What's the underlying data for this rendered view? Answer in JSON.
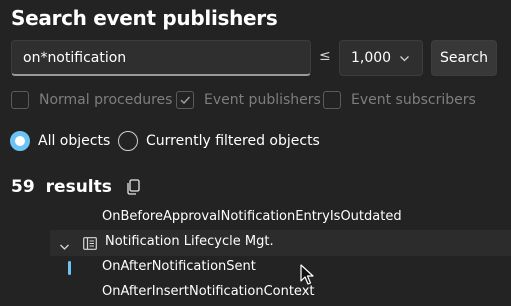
{
  "header": {
    "title": "Search event publishers"
  },
  "search": {
    "query": "on*notification",
    "le_symbol": "≤",
    "limit_value": "1,000",
    "button_label": "Search"
  },
  "filters": {
    "checkboxes": [
      {
        "label": "Normal procedures",
        "checked": false
      },
      {
        "label": "Event publishers",
        "checked": true
      },
      {
        "label": "Event subscribers",
        "checked": false
      }
    ]
  },
  "scope": {
    "options": [
      {
        "label": "All objects",
        "selected": true
      },
      {
        "label": "Currently filtered objects",
        "selected": false
      }
    ]
  },
  "results": {
    "count": "59",
    "label": "results",
    "items": [
      {
        "label": "OnBeforeApprovalNotificationEntryIsOutdated"
      },
      {
        "label": "Notification Lifecycle Mgt.",
        "type": "group",
        "expanded": true
      },
      {
        "label": "OnAfterNotificationSent",
        "selected": true
      },
      {
        "label": "OnAfterInsertNotificationContext"
      }
    ]
  },
  "colors": {
    "accent": "#6cc4f5",
    "background": "#232323"
  }
}
